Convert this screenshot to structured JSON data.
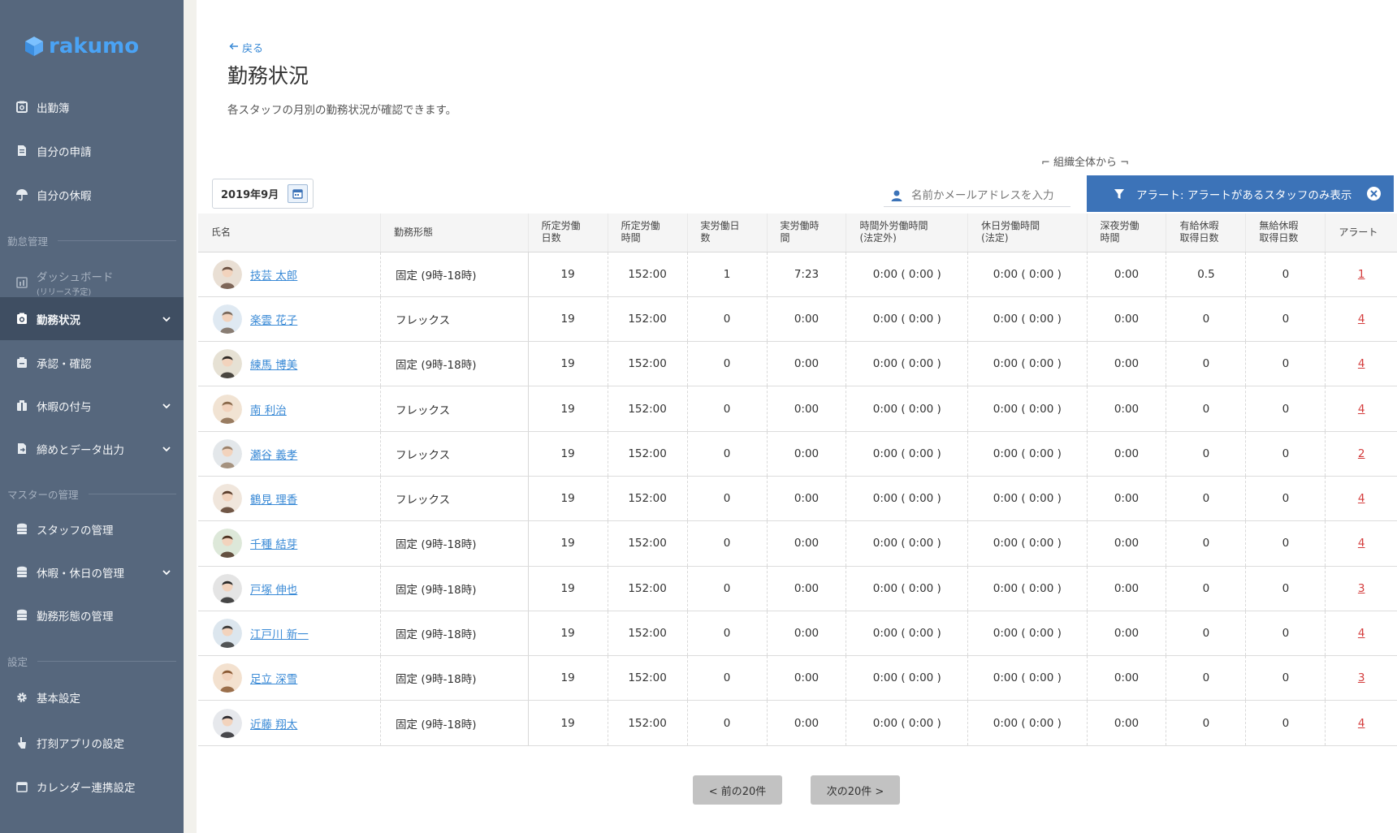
{
  "app": {
    "logo_text": "rakumo",
    "brand_color": "#4aa3f5",
    "sidebar_bg": "#56677d",
    "active_bg": "#3f4e62",
    "accent": "#3c73b8",
    "alert_color": "#d43c3c"
  },
  "sidebar": {
    "items": [
      {
        "label": "出勤簿",
        "icon": "clipboard-icon"
      },
      {
        "label": "自分の申請",
        "icon": "document-icon"
      },
      {
        "label": "自分の休暇",
        "icon": "umbrella-icon"
      },
      {
        "label": "ダッシュボード",
        "sub": "(リリース予定)",
        "icon": "dashboard-icon"
      },
      {
        "label": "勤務状況",
        "icon": "clipboard-check-icon"
      },
      {
        "label": "承認・確認",
        "icon": "stamp-icon"
      },
      {
        "label": "休暇の付与",
        "icon": "gift-icon"
      },
      {
        "label": "締めとデータ出力",
        "icon": "export-icon"
      },
      {
        "label": "スタッフの管理",
        "icon": "database-icon"
      },
      {
        "label": "休暇・休日の管理",
        "icon": "database-calendar-icon"
      },
      {
        "label": "勤務形態の管理",
        "icon": "database-clock-icon"
      },
      {
        "label": "基本設定",
        "icon": "gear-icon"
      },
      {
        "label": "打刻アプリの設定",
        "icon": "hand-icon"
      },
      {
        "label": "カレンダー連携設定",
        "icon": "calendar-icon"
      }
    ],
    "sections": [
      "勤怠管理",
      "マスターの管理",
      "設定"
    ]
  },
  "header": {
    "back_label": "戻る",
    "title": "勤務状況",
    "description": "各スタッフの月別の勤務状況が確認できます。",
    "scope_label": "⌐ 組織全体から ¬"
  },
  "toolbar": {
    "month": "2019年9月",
    "search_placeholder": "名前かメールアドレスを入力",
    "alert_filter_label": "アラート: アラートがあるスタッフのみ表示"
  },
  "table": {
    "columns": [
      "氏名",
      "勤務形態",
      "所定労働\n日数",
      "所定労働\n時間",
      "実労働日\n数",
      "実労働時\n間",
      "時間外労働時間\n(法定外)",
      "休日労働時間\n(法定)",
      "深夜労働\n時間",
      "有給休暇\n取得日数",
      "無給休暇\n取得日数",
      "アラート"
    ],
    "rows": [
      {
        "name": "技芸 太郎",
        "type": "固定 (9時-18時)",
        "sched_days": "19",
        "sched_hours": "152:00",
        "work_days": "1",
        "work_hours": "7:23",
        "overtime": "0:00 ( 0:00 )",
        "holiday": "0:00 ( 0:00 )",
        "night": "0:00",
        "paid": "0.5",
        "unpaid": "0",
        "alerts": "1"
      },
      {
        "name": "楽雲 花子",
        "type": "フレックス",
        "sched_days": "19",
        "sched_hours": "152:00",
        "work_days": "0",
        "work_hours": "0:00",
        "overtime": "0:00 ( 0:00 )",
        "holiday": "0:00 ( 0:00 )",
        "night": "0:00",
        "paid": "0",
        "unpaid": "0",
        "alerts": "4"
      },
      {
        "name": "練馬 博美",
        "type": "固定 (9時-18時)",
        "sched_days": "19",
        "sched_hours": "152:00",
        "work_days": "0",
        "work_hours": "0:00",
        "overtime": "0:00 ( 0:00 )",
        "holiday": "0:00 ( 0:00 )",
        "night": "0:00",
        "paid": "0",
        "unpaid": "0",
        "alerts": "4"
      },
      {
        "name": "南 利治",
        "type": "フレックス",
        "sched_days": "19",
        "sched_hours": "152:00",
        "work_days": "0",
        "work_hours": "0:00",
        "overtime": "0:00 ( 0:00 )",
        "holiday": "0:00 ( 0:00 )",
        "night": "0:00",
        "paid": "0",
        "unpaid": "0",
        "alerts": "4"
      },
      {
        "name": "瀬谷 義孝",
        "type": "フレックス",
        "sched_days": "19",
        "sched_hours": "152:00",
        "work_days": "0",
        "work_hours": "0:00",
        "overtime": "0:00 ( 0:00 )",
        "holiday": "0:00 ( 0:00 )",
        "night": "0:00",
        "paid": "0",
        "unpaid": "0",
        "alerts": "2"
      },
      {
        "name": "鶴見 理香",
        "type": "フレックス",
        "sched_days": "19",
        "sched_hours": "152:00",
        "work_days": "0",
        "work_hours": "0:00",
        "overtime": "0:00 ( 0:00 )",
        "holiday": "0:00 ( 0:00 )",
        "night": "0:00",
        "paid": "0",
        "unpaid": "0",
        "alerts": "4"
      },
      {
        "name": "千種 結芽",
        "type": "固定 (9時-18時)",
        "sched_days": "19",
        "sched_hours": "152:00",
        "work_days": "0",
        "work_hours": "0:00",
        "overtime": "0:00 ( 0:00 )",
        "holiday": "0:00 ( 0:00 )",
        "night": "0:00",
        "paid": "0",
        "unpaid": "0",
        "alerts": "4"
      },
      {
        "name": "戸塚 伸也",
        "type": "固定 (9時-18時)",
        "sched_days": "19",
        "sched_hours": "152:00",
        "work_days": "0",
        "work_hours": "0:00",
        "overtime": "0:00 ( 0:00 )",
        "holiday": "0:00 ( 0:00 )",
        "night": "0:00",
        "paid": "0",
        "unpaid": "0",
        "alerts": "3"
      },
      {
        "name": "江戸川 新一",
        "type": "固定 (9時-18時)",
        "sched_days": "19",
        "sched_hours": "152:00",
        "work_days": "0",
        "work_hours": "0:00",
        "overtime": "0:00 ( 0:00 )",
        "holiday": "0:00 ( 0:00 )",
        "night": "0:00",
        "paid": "0",
        "unpaid": "0",
        "alerts": "4"
      },
      {
        "name": "足立 深雪",
        "type": "固定 (9時-18時)",
        "sched_days": "19",
        "sched_hours": "152:00",
        "work_days": "0",
        "work_hours": "0:00",
        "overtime": "0:00 ( 0:00 )",
        "holiday": "0:00 ( 0:00 )",
        "night": "0:00",
        "paid": "0",
        "unpaid": "0",
        "alerts": "3"
      },
      {
        "name": "近藤 翔太",
        "type": "固定 (9時-18時)",
        "sched_days": "19",
        "sched_hours": "152:00",
        "work_days": "0",
        "work_hours": "0:00",
        "overtime": "0:00 ( 0:00 )",
        "holiday": "0:00 ( 0:00 )",
        "night": "0:00",
        "paid": "0",
        "unpaid": "0",
        "alerts": "4"
      }
    ]
  },
  "pagination": {
    "prev_label": "< 前の20件",
    "next_label": "次の20件 >"
  }
}
